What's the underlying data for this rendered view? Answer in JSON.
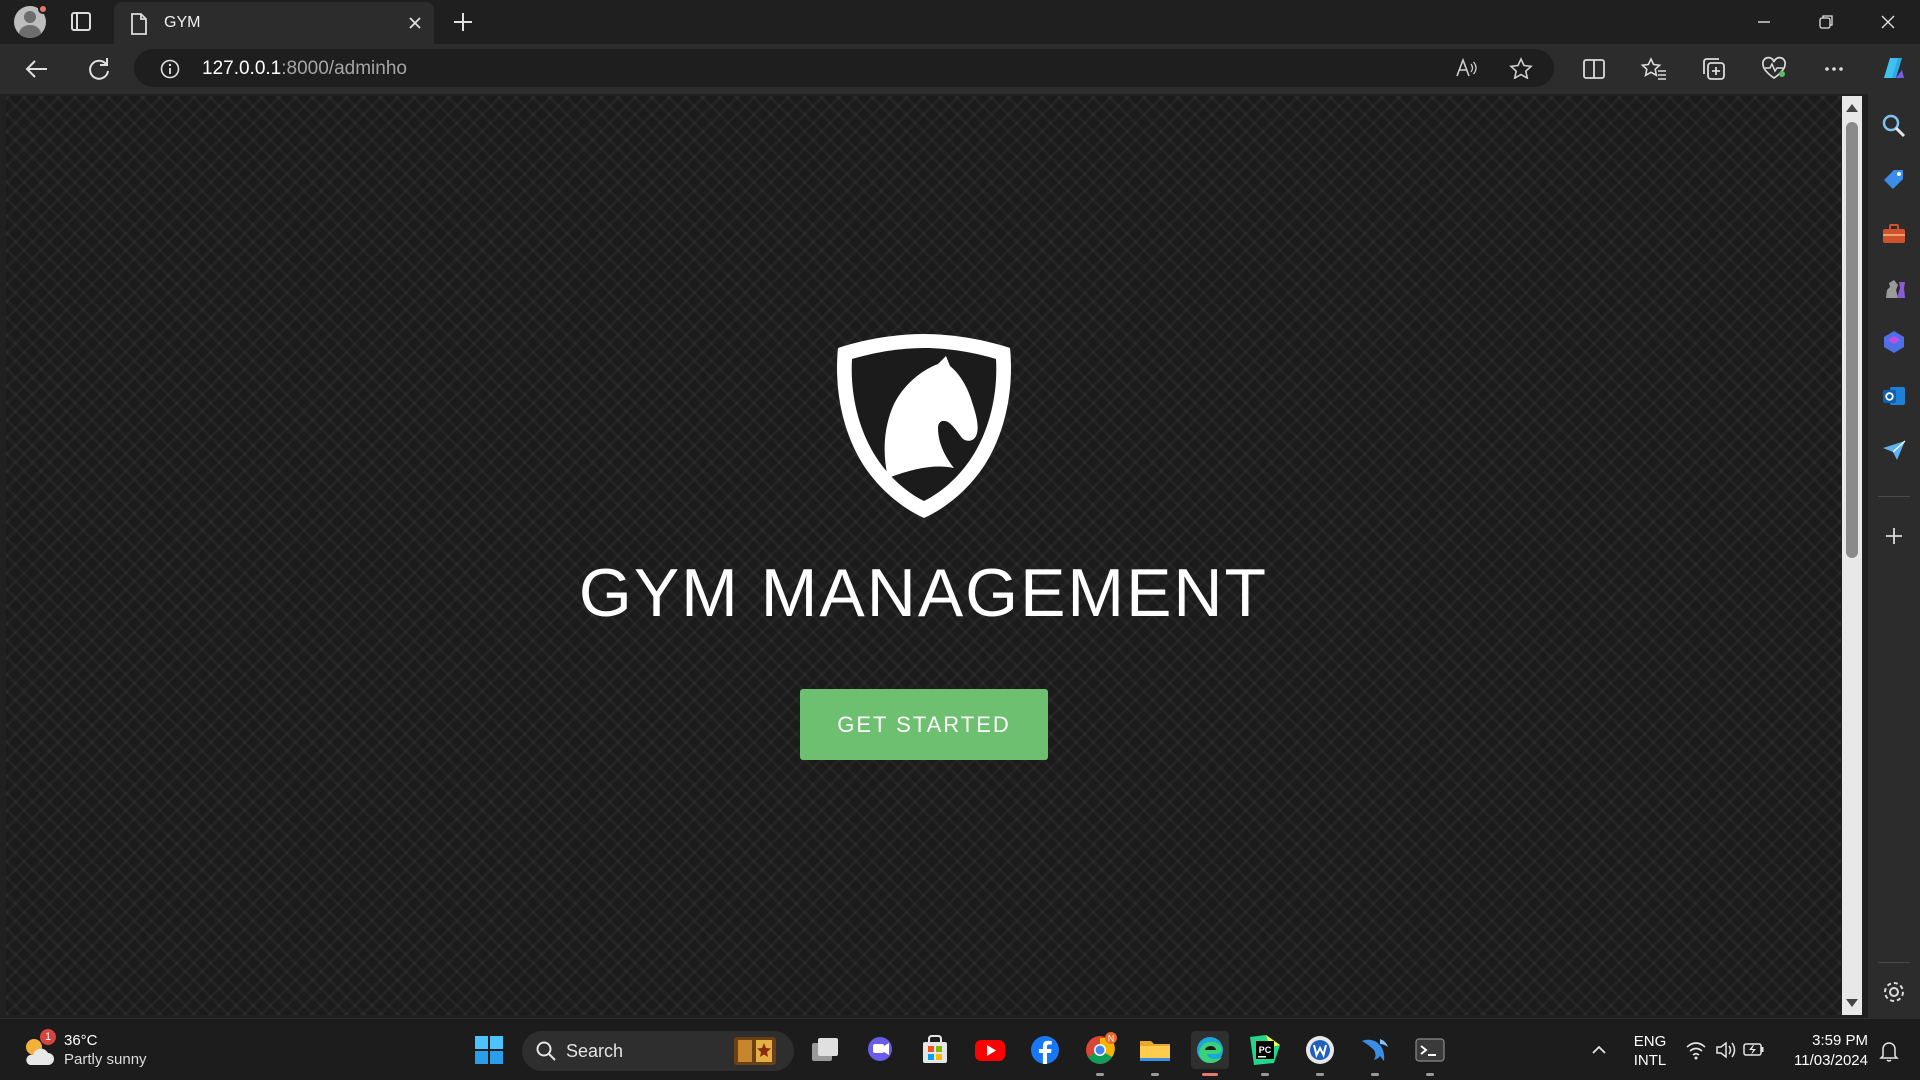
{
  "tab": {
    "title": "GYM"
  },
  "address": {
    "host": "127.0.0.1",
    "path": ":8000/adminho"
  },
  "page": {
    "heading": "GYM MANAGEMENT",
    "cta_label": "GET STARTED",
    "accent_color": "#6cc070"
  },
  "taskbar": {
    "weather_temp": "36°C",
    "weather_desc": "Partly sunny",
    "weather_badge": "1",
    "search_label": "Search",
    "lang_top": "ENG",
    "lang_bottom": "INTL",
    "time": "3:59 PM",
    "date": "11/03/2024",
    "chrome_badge": "N"
  }
}
